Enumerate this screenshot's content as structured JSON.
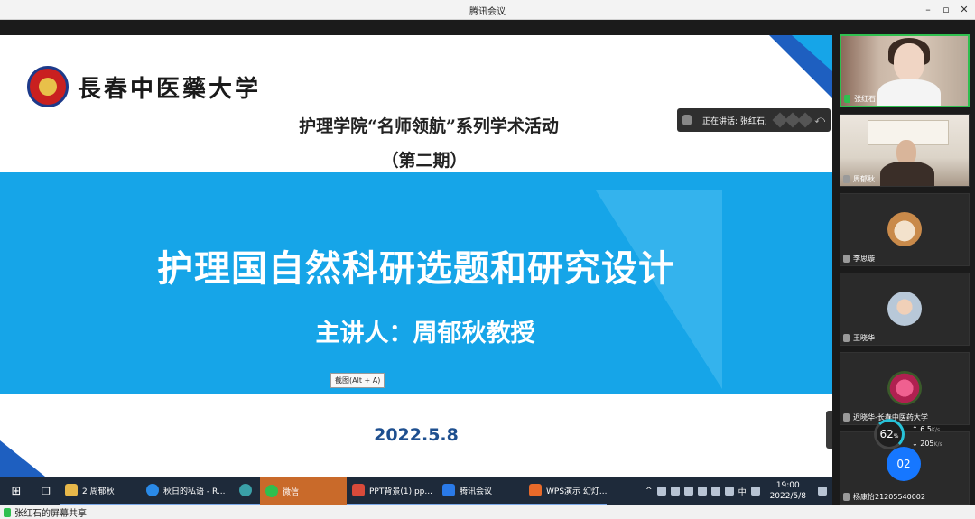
{
  "window": {
    "title": "腾讯会议",
    "controls": [
      "–",
      "▫",
      "✕"
    ]
  },
  "slide": {
    "school_name": "長春中医藥大学",
    "subtitle1": "护理学院“名师领航”系列学术活动",
    "subtitle2": "（第二期）",
    "main_title": "护理国自然科研选题和研究设计",
    "speaker": "主讲人：周郁秋教授",
    "date": "2022.5.8"
  },
  "screenshot_tip": "截图(Alt + A)",
  "speaking_bar": {
    "label": "正在讲话: 张红石;"
  },
  "participants": [
    {
      "name": "张红石",
      "mic_on": true
    },
    {
      "name": "周郁秋",
      "mic_on": false
    },
    {
      "name": "李思璇",
      "mic_on": false
    },
    {
      "name": "王晓华",
      "mic_on": false
    },
    {
      "name": "迟晓华-长春中医药大学",
      "mic_on": false
    },
    {
      "name": "杨康怡21205540002",
      "mic_on": false
    }
  ],
  "network": {
    "percent": "62",
    "unit": "%",
    "up": "6.5",
    "down": "205",
    "rate_unit": "K/s"
  },
  "badge": "02",
  "taskbar": {
    "items": [
      "2 周郁秋",
      "秋日的私语 - R...",
      "微信",
      "PPT背景(1).pp...",
      "腾讯会议",
      "WPS演示 幻灯..."
    ],
    "ime": "中",
    "time": "19:00",
    "date": "2022/5/8"
  },
  "share_label": "张红石的屏幕共享"
}
